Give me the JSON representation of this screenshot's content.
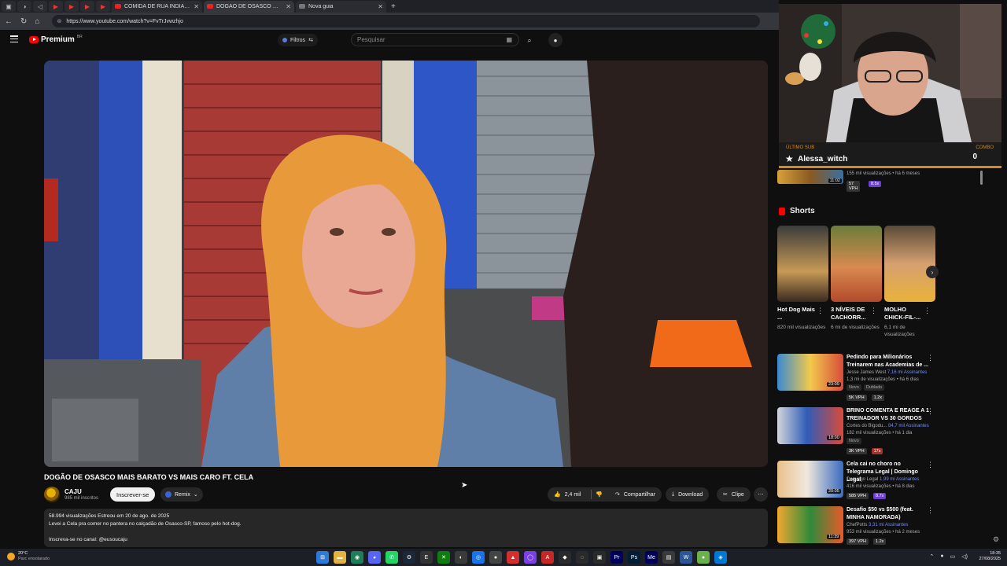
{
  "browser": {
    "tabs": [
      {
        "label": "COMIDA DE RUA INDIANA"
      },
      {
        "label": "DOGÃO DE OSASCO MAIS BARATO"
      },
      {
        "label": "Nova guia"
      }
    ],
    "new_tab_symbol": "+",
    "url": "https://www.youtube.com/watch?v=FvTrJvwzhjo"
  },
  "header": {
    "logo_text": "Premium",
    "logo_suffix": "BR",
    "filters_label": "Filtros",
    "search_placeholder": "Pesquisar"
  },
  "video": {
    "title": "DOGÃO DE OSASCO MAIS BARATO VS MAIS CARO FT. CELA",
    "channel": "CAJU",
    "subscribers": "985 mil inscritos",
    "subscribe_label": "Inscrever-se",
    "remix_label": "Remix",
    "likes": "2,4 mil",
    "share_label": "Compartilhar",
    "download_label": "Download",
    "clip_label": "Clipe",
    "description": {
      "line1": "58.994 visualizações  Estreou em 20 de ago. de 2025",
      "line2": "Levei a Cela pra comer no pantera no calçadão de Osasco-SP, famoso pelo hot-dog.",
      "line3": "Inscreva-se no canal: @eusoucaju"
    }
  },
  "stream_overlay": {
    "last_sub_label": "ÚLTIMO SUB",
    "last_sub_name": "Alessa_witch",
    "combo_label": "COMBO",
    "combo_count": "0"
  },
  "sidebar": {
    "partial_item": {
      "duration": "11:02",
      "meta": "155 mil visualizações • há 6 meses",
      "vph": "57 VPH",
      "ratio": "8.5x"
    },
    "shorts_title": "Shorts",
    "shorts": [
      {
        "title": "Hot Dog Mais ...",
        "views": "820 mil visualizações"
      },
      {
        "title": "3 NÍVEIS DE CACHORR...",
        "views": "6 mi de visualizações"
      },
      {
        "title": "MOLHO CHICK-FIL-...",
        "views": "6,1 mi de visualizações"
      }
    ],
    "videos": [
      {
        "title": "Pedindo para Milionários Treinarem nas Academias de ...",
        "channel": "Jesse James West",
        "channel_subs": "7,16 mi Assinantes",
        "stats": "1,3 mi de visualizações • há 6 dias",
        "badges": [
          "Novo",
          "Dublado"
        ],
        "duration": "23:09",
        "vph": "5K VPH",
        "ratio": "1.2x"
      },
      {
        "title": "BRINO COMENTA E REAGE A 1 TREINADOR VS 30 GORDOS",
        "channel": "Cortes do Bigodu...",
        "channel_subs": "84,7 mil Assinantes",
        "stats": "182 mil visualizações • há 1 dia",
        "badges": [
          "Novo"
        ],
        "duration": "18:00",
        "vph": "3K VPH",
        "ratio": "17x"
      },
      {
        "title": "Cela cai no choro no Telegrama Legal | Domingo Legal",
        "channel": "Domingo Legal",
        "channel_subs": "1,99 mi Assinantes",
        "stats": "416 mil visualizações • há 8 dias",
        "badges": [],
        "duration": "20:05",
        "vph": "585 VPH",
        "ratio": "8.7x"
      },
      {
        "title": "Desafio $50 vs $500 (feat. MINHA NAMORADA)",
        "channel": "ChefPotts",
        "channel_subs": "3,31 mi Assinantes",
        "stats": "953 mil visualizações • há 2 meses",
        "badges": [],
        "duration": "11:39",
        "vph": "397 VPH",
        "ratio": "1.2x"
      }
    ]
  },
  "taskbar": {
    "temperature": "20°C",
    "weather": "Parc ensolarado",
    "time": "18:35",
    "date": "27/08/2025"
  },
  "colors": {
    "background": "#0f0f0f",
    "accent_red": "#ff0000",
    "overlay_orange": "#d08a2a",
    "vph_purple": "#6b3fd1"
  }
}
